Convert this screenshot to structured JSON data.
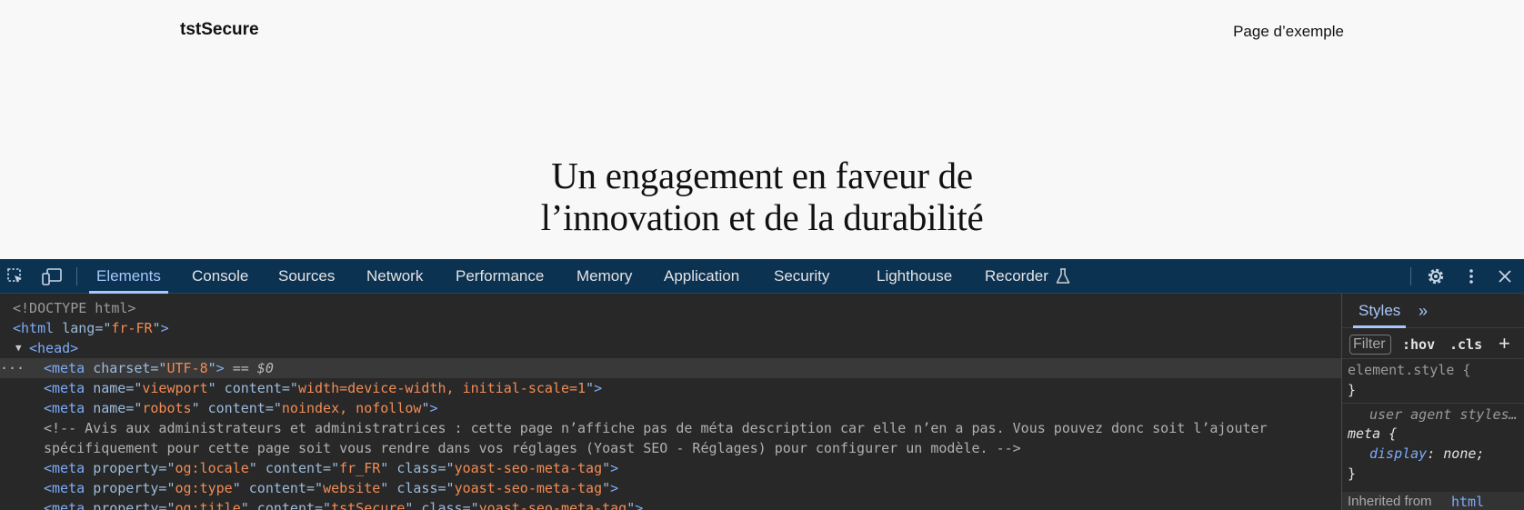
{
  "site": {
    "title": "tstSecure",
    "nav_item": "Page d’exemple",
    "hero_line1": "Un engagement en faveur de",
    "hero_line2": "l’innovation et de la durabilité"
  },
  "devtools": {
    "tabs": [
      "Elements",
      "Console",
      "Sources",
      "Network",
      "Performance",
      "Memory",
      "Application",
      "Security",
      "Lighthouse",
      "Recorder"
    ],
    "active_tab": "Elements",
    "icons": [
      "inspect-element-icon",
      "device-toolbar-icon",
      "flask-icon",
      "gear-icon",
      "more-vertical-icon",
      "close-icon"
    ],
    "elements": {
      "doctype": "<!DOCTYPE html>",
      "html_open": "<html",
      "html_attr": "lang",
      "html_lang": "fr-FR",
      "head_tag": "<head>",
      "meta1_attr": "charset",
      "meta1_val": "UTF-8",
      "selected_marker": "== $0",
      "meta2": {
        "name": "viewport",
        "content": "width=device-width, initial-scale=1"
      },
      "meta3": {
        "name": "robots",
        "content": "noindex, nofollow"
      },
      "comment_line1": "<!-- Avis aux administrateurs et administratrices : cette page n’affiche pas de méta description car elle n’en a pas. Vous pouvez donc soit l’ajouter",
      "comment_line2": "spécifiquement pour cette page soit vous rendre dans vos réglages (Yoast SEO - Réglages) pour configurer un modèle. -->",
      "og_locale": {
        "property": "og:locale",
        "content": "fr_FR",
        "class": "yoast-seo-meta-tag"
      },
      "og_type": {
        "property": "og:type",
        "content": "website",
        "class": "yoast-seo-meta-tag"
      },
      "og_title": {
        "property": "og:title",
        "content": "tstSecure",
        "class": "yoast-seo-meta-tag"
      }
    },
    "styles": {
      "tab": "Styles",
      "more": "»",
      "filter_placeholder": "Filter",
      "hov": ":hov",
      "cls": ".cls",
      "plus": "+",
      "element_style": "element.style {",
      "close_brace": "}",
      "ua_label": "user agent styles…",
      "meta_selector": "meta {",
      "display_prop": "display",
      "display_value": ": none;",
      "inherited_label": "Inherited from",
      "inherited_from": "html"
    }
  },
  "colors": {
    "tabbar_bg": "#0c3252",
    "panel_bg": "#282828",
    "active_tab": "#a8c7fa",
    "tag": "#7cacf8",
    "attr_value": "#f28b54"
  }
}
